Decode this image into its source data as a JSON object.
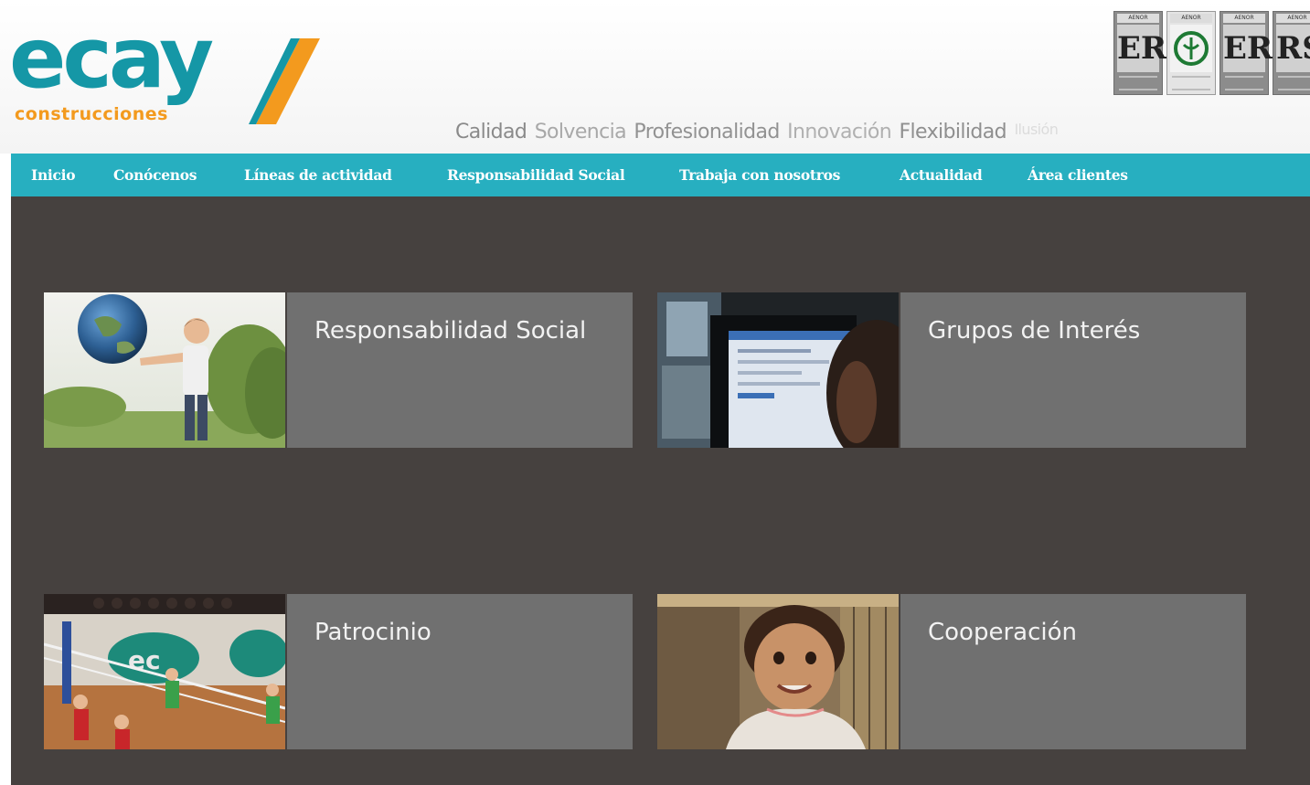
{
  "brand": {
    "logo_word": "ecay",
    "logo_subtitle": "construcciones",
    "colors": {
      "teal": "#1597a6",
      "orange": "#f39a1e",
      "nav": "#27afc0",
      "body": "#46413f",
      "panel": "#707070"
    }
  },
  "certifications": [
    {
      "label": "AENOR",
      "mark": "ER",
      "icon": "aenor-er-certificate-icon"
    },
    {
      "label": "AENOR",
      "mark": "GA",
      "icon": "aenor-environment-certificate-icon"
    },
    {
      "label": "AENOR",
      "mark": "ER",
      "icon": "aenor-er-certificate-icon"
    },
    {
      "label": "AENOR",
      "mark": "RS",
      "icon": "aenor-rs-certificate-icon"
    }
  ],
  "values_line": [
    "Calidad",
    "Solvencia",
    "Profesionalidad",
    "Innovación",
    "Flexibilidad",
    "Ilusión"
  ],
  "nav": {
    "items": [
      {
        "label": "Inicio"
      },
      {
        "label": "Conócenos"
      },
      {
        "label": "Líneas de actividad"
      },
      {
        "label": "Responsabilidad Social"
      },
      {
        "label": "Trabaja con nosotros"
      },
      {
        "label": "Actualidad"
      },
      {
        "label": "Área clientes"
      }
    ]
  },
  "tiles": [
    {
      "title": "Responsabilidad Social",
      "image": "child-holding-globe-photo"
    },
    {
      "title": "Grupos de Interés",
      "image": "person-at-computer-photo"
    },
    {
      "title": "Patrocinio",
      "image": "volleyball-match-photo"
    },
    {
      "title": "Cooperación",
      "image": "smiling-child-photo"
    }
  ]
}
